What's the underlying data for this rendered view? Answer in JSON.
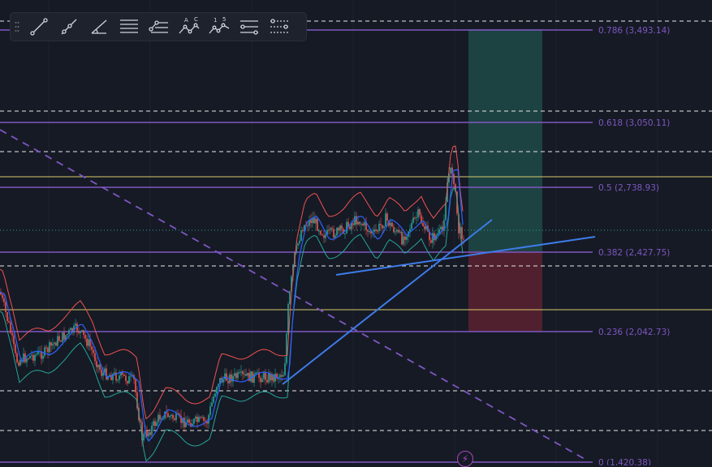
{
  "toolbar": {
    "tools": [
      {
        "name": "trend-line-icon"
      },
      {
        "name": "ray-icon"
      },
      {
        "name": "trend-angle-icon"
      },
      {
        "name": "fib-retracement-icon",
        "label": ""
      },
      {
        "name": "fib-extension-icon"
      },
      {
        "name": "abcd-pattern-icon",
        "label": "A C"
      },
      {
        "name": "elliott-wave-icon",
        "label": "1 5"
      },
      {
        "name": "date-range-icon"
      },
      {
        "name": "price-range-icon"
      }
    ]
  },
  "fib_levels": [
    {
      "ratio": "0.786",
      "label": "0.786 (3,493.14)"
    },
    {
      "ratio": "0.618",
      "label": "0.618 (3,050.11)"
    },
    {
      "ratio": "0.5",
      "label": "0.5 (2,738.93)"
    },
    {
      "ratio": "0.382",
      "label": "0.382 (2,427.75)"
    },
    {
      "ratio": "0.236",
      "label": "0.236 (2,042.73)"
    },
    {
      "ratio": "0",
      "label": "0 (1,420.38)"
    }
  ],
  "colors": {
    "background": "#161a25",
    "fib_line": "#7e57c2",
    "horizontal_yellow": "#d8cc6a",
    "dashed_white": "#ffffff",
    "trendline": "#3d7ce8",
    "long_profit_zone": "#1e4a48",
    "long_loss_zone": "#5a2230",
    "candle_up": "#26a69a",
    "candle_down": "#ef5350"
  },
  "alert_icon": {
    "name": "lightning-alert-icon",
    "glyph": "⚡"
  }
}
